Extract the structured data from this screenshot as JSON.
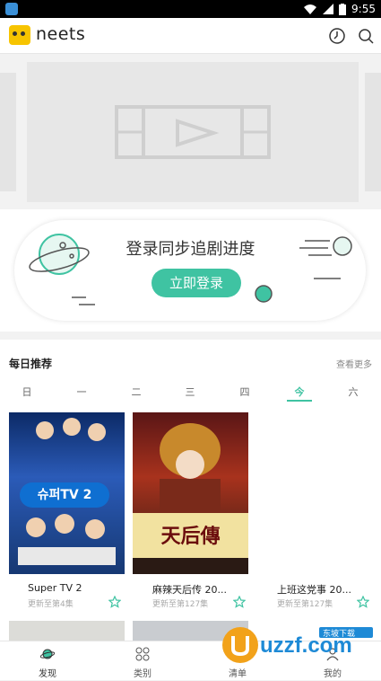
{
  "status_bar": {
    "time": "9:55"
  },
  "app_bar": {
    "title": "neets"
  },
  "hero": {
    "icon": "video-placeholder-icon"
  },
  "login": {
    "title": "登录同步追剧进度",
    "button_label": "立即登录"
  },
  "recommend": {
    "title": "每日推荐",
    "more_label": "查看更多",
    "weekdays": [
      "日",
      "一",
      "二",
      "三",
      "四",
      "今",
      "六"
    ],
    "active_weekday": "今",
    "items": [
      {
        "name": "Super TV 2",
        "subtitle": "更新至第4集",
        "poster_text": "슈퍼TV 2"
      },
      {
        "name": "麻辣天后传 20...",
        "subtitle": "更新至第127集",
        "poster_text": "天后傳"
      },
      {
        "name": "上班这党事 20...",
        "subtitle": "更新至第127集"
      }
    ]
  },
  "tabs": [
    {
      "label": "发现",
      "icon": "planet-icon"
    },
    {
      "label": "类别",
      "icon": "grid-circles-icon"
    },
    {
      "label": "清单",
      "icon": "list-icon"
    },
    {
      "label": "我的",
      "icon": "profile-icon"
    }
  ],
  "watermark": {
    "text": "uzzf.com",
    "sub": "东坡下载"
  },
  "colors": {
    "accent": "#3fc3a2",
    "logo": "#f7c400"
  }
}
